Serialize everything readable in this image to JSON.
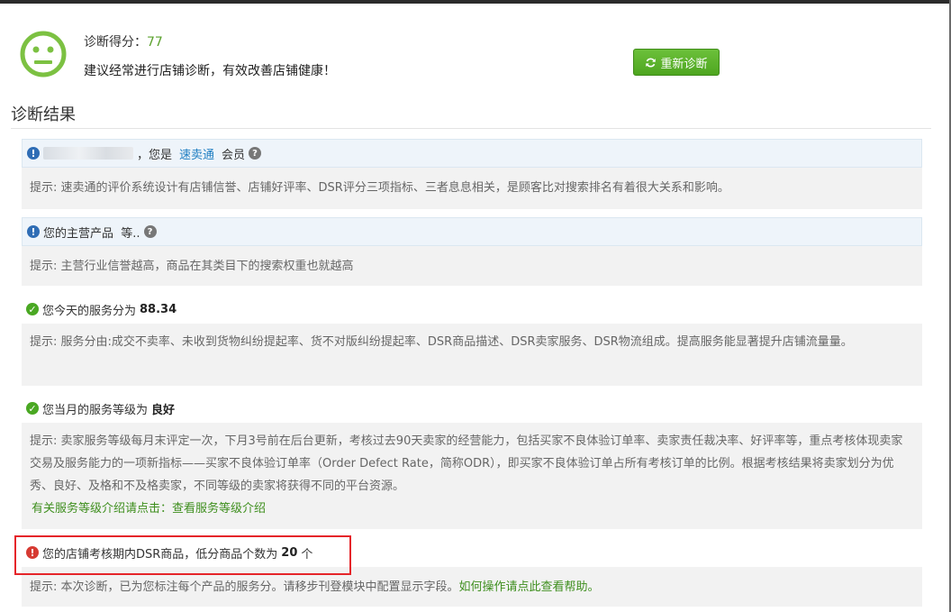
{
  "header": {
    "score_label": "诊断得分：",
    "score_value": "77",
    "advice": "建议经常进行店铺诊断，有效改善店铺健康！",
    "rediagnose_label": "重新诊断"
  },
  "section_title": "诊断结果",
  "items": [
    {
      "status": "info",
      "head_mid": "，您是",
      "head_link": "速卖通",
      "head_tail": "会员",
      "tip_label": "提示:",
      "tip": "速卖通的评价系统设计有店铺信誉、店铺好评率、DSR评分三项指标、三者息息相关，是顾客比对搜索排名有着很大关系和影响。"
    },
    {
      "status": "info",
      "head": "您的主营产品  等..",
      "tip_label": "提示:",
      "tip": "主营行业信誉越高，商品在其类目下的搜索权重也就越高"
    },
    {
      "status": "ok",
      "head": "您今天的服务分为",
      "head_value": "88.34",
      "tip_label": "提示:",
      "tip": "服务分由:成交不卖率、未收到货物纠纷提起率、货不对版纠纷提起率、DSR商品描述、DSR卖家服务、DSR物流组成。提高服务能显著提升店铺流量量。"
    },
    {
      "status": "ok",
      "head": "您当月的服务等级为",
      "head_value": "良好",
      "tip_label": "提示:",
      "tip": "卖家服务等级每月末评定一次，下月3号前在后台更新，考核过去90天卖家的经营能力，包括买家不良体验订单率、卖家责任裁决率、好评率等，重点考核体现卖家交易及服务能力的一项新指标——买家不良体验订单率（Order Defect Rate，简称ODR），即买家不良体验订单占所有考核订单的比例。根据考核结果将卖家划分为优秀、良好、及格和不及格卖家，不同等级的卖家将获得不同的平台资源。",
      "link_text": "有关服务等级介绍请点击：查看服务等级介绍"
    },
    {
      "status": "warn",
      "head": "您的店铺考核期内DSR商品，低分商品个数为",
      "head_value": "20",
      "head_unit": "个",
      "tip_label": "提示:",
      "tip": "本次诊断，已为您标注每个产品的服务分。请移步刊登模块中配置显示字段。",
      "tip_link": "如何操作请点此查看帮助。"
    }
  ],
  "colors": {
    "accent_green": "#5aa12c",
    "link_blue": "#1f7ec2",
    "highlight_red": "#e5252a"
  }
}
